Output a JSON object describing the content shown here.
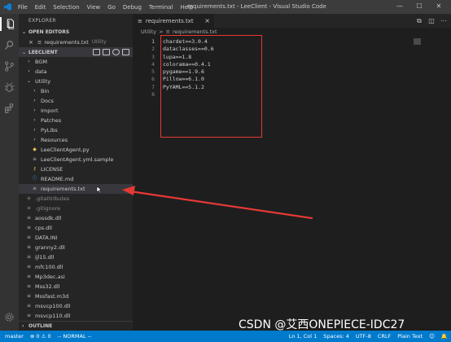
{
  "titlebar": {
    "menu": [
      "File",
      "Edit",
      "Selection",
      "View",
      "Go",
      "Debug",
      "Terminal",
      "Help"
    ],
    "title": "requirements.txt - LeeClient - Visual Studio Code",
    "controls": [
      "—",
      "☐",
      "✕"
    ]
  },
  "activitybar": {
    "icons": [
      "files-icon",
      "search-icon",
      "source-control-icon",
      "debug-icon",
      "extensions-icon"
    ],
    "settings_icon": "gear-icon"
  },
  "sidebar": {
    "title": "EXPLORER",
    "open_editors_label": "OPEN EDITORS",
    "open_editor": {
      "name": "requirements.txt",
      "folder": "Utility"
    },
    "project_label": "LEECLIENT",
    "tree": [
      {
        "label": "BGM",
        "type": "folder-closed",
        "depth": 1
      },
      {
        "label": "data",
        "type": "folder-closed",
        "depth": 1
      },
      {
        "label": "Utility",
        "type": "folder-open",
        "depth": 1
      },
      {
        "label": "Bin",
        "type": "folder-closed",
        "depth": 2
      },
      {
        "label": "Docs",
        "type": "folder-closed",
        "depth": 2
      },
      {
        "label": "Import",
        "type": "folder-closed",
        "depth": 2
      },
      {
        "label": "Patches",
        "type": "folder-closed",
        "depth": 2
      },
      {
        "label": "PyLibs",
        "type": "folder-closed",
        "depth": 2
      },
      {
        "label": "Resources",
        "type": "folder-closed",
        "depth": 2
      },
      {
        "label": "LeeClientAgent.py",
        "type": "python",
        "depth": 2
      },
      {
        "label": "LeeClientAgent.yml.sample",
        "type": "text",
        "depth": 2
      },
      {
        "label": "LICENSE",
        "type": "license",
        "depth": 2
      },
      {
        "label": "README.md",
        "type": "info",
        "depth": 2
      },
      {
        "label": "requirements.txt",
        "type": "text",
        "depth": 2,
        "selected": true
      },
      {
        "label": ".gitattributes",
        "type": "git",
        "depth": 1
      },
      {
        "label": ".gitignore",
        "type": "git",
        "depth": 1
      },
      {
        "label": "aossdk.dll",
        "type": "text",
        "depth": 1
      },
      {
        "label": "cps.dll",
        "type": "text",
        "depth": 1
      },
      {
        "label": "DATA.INI",
        "type": "text",
        "depth": 1
      },
      {
        "label": "granny2.dll",
        "type": "text",
        "depth": 1
      },
      {
        "label": "ijl15.dll",
        "type": "text",
        "depth": 1
      },
      {
        "label": "mfc100.dll",
        "type": "text",
        "depth": 1
      },
      {
        "label": "Mp3dec.asi",
        "type": "text",
        "depth": 1
      },
      {
        "label": "Mss32.dll",
        "type": "text",
        "depth": 1
      },
      {
        "label": "Mssfast.m3d",
        "type": "text",
        "depth": 1
      },
      {
        "label": "msvcp100.dll",
        "type": "text",
        "depth": 1
      },
      {
        "label": "msvcp110.dll",
        "type": "text",
        "depth": 1
      }
    ],
    "outline_label": "OUTLINE"
  },
  "editor": {
    "tab_label": "requirements.txt",
    "breadcrumb": [
      "Utility",
      ">",
      "requirements.txt"
    ],
    "lines": [
      "chardet==3.0.4",
      "dataclasses==0.6",
      "lupa==1.8",
      "colorama==0.4.1",
      "pygame==1.9.6",
      "Pillow==6.1.0",
      "PyYAML==5.1.2",
      ""
    ],
    "line_numbers": [
      "1",
      "2",
      "3",
      "4",
      "5",
      "6",
      "7",
      "8"
    ]
  },
  "statusbar": {
    "left": [
      "master",
      "⊗ 0 ⚠ 0",
      "-- NORMAL --"
    ],
    "right": [
      "Ln 1, Col 1",
      "Spaces: 4",
      "UTF-8",
      "CRLF",
      "Plain Text",
      "☺",
      "🔔"
    ]
  },
  "watermark": "CSDN @艾西ONEPIECE-IDC27",
  "colors": {
    "accent": "#007acc",
    "annotation": "#e53935",
    "editor_bg": "#1e1e1e",
    "sidebar_bg": "#252526"
  }
}
